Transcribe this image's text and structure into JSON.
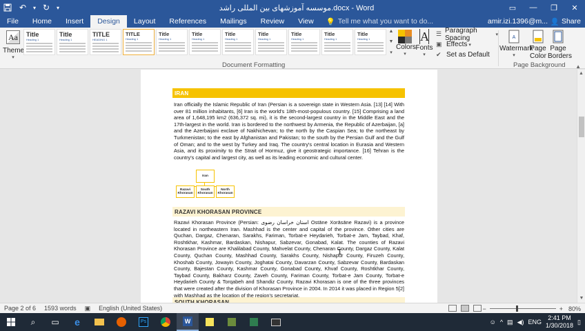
{
  "window": {
    "title": "موسسه آموزشهای بین المللی راشد.docx - Word",
    "controls": [
      "minimize",
      "restore",
      "maximize",
      "close"
    ]
  },
  "quick_access": [
    "save-icon",
    "undo-icon",
    "redo-icon",
    "customize-icon"
  ],
  "ribbon_tabs": [
    "File",
    "Home",
    "Insert",
    "Design",
    "Layout",
    "References",
    "Mailings",
    "Review",
    "View"
  ],
  "active_tab": "Design",
  "tell_me": "Tell me what you want to do...",
  "account": "amir.izi.1396@m...",
  "share": "Share",
  "ribbon": {
    "themes_label": "Themes",
    "style_gallery": [
      {
        "title": "Title",
        "heading": "Heading 1"
      },
      {
        "title": "Title",
        "heading": "Heading 1"
      },
      {
        "title": "TITLE",
        "heading": "HEADING 1"
      },
      {
        "title": "TITLE",
        "heading": "Heading 1"
      },
      {
        "title": "Title",
        "heading": "Heading 1"
      },
      {
        "title": "Title",
        "heading": "Heading 1"
      },
      {
        "title": "Title",
        "heading": "Heading 1"
      },
      {
        "title": "Title",
        "heading": "Heading 1"
      },
      {
        "title": "Title",
        "heading": "Heading 1"
      },
      {
        "title": "Title",
        "heading": "Heading 1"
      },
      {
        "title": "Title",
        "heading": "Heading 1"
      }
    ],
    "colors_label": "Colors",
    "fonts_label": "Fonts",
    "paragraph_spacing": "Paragraph Spacing",
    "effects": "Effects",
    "set_as_default": "Set as Default",
    "document_formatting_group": "Document Formatting",
    "watermark": "Watermark",
    "page_color": "Page Color",
    "page_borders": "Page Borders",
    "page_background_group": "Page Background",
    "theme_colors": [
      "#f6c200",
      "#e98d22",
      "#2b2b2b",
      "#7a7a7a"
    ]
  },
  "document": {
    "heading1": "IRAN",
    "para1": "Iran officially the Islamic Republic of Iran (Persian is a sovereign state in Western Asia. [13] [14] With over 81 million inhabitants, [6] Iran is the world's 18th-most-populous country. [15] Comprising a land area of 1,648,195 km2 (636,372 sq. mi), it is the second-largest country in the Middle East and the 17th-largest in the world. Iran is bordered to the northwest by Armenia, the Republic of Azerbaijan, [a] and the Azerbaijani exclave of Nakhichevan; to the north by the Caspian Sea; to the northeast by Turkmenistan; to the east by Afghanistan and Pakistan; to the south by the Persian Gulf and the Gulf of Oman; and to the west by Turkey and Iraq. The country's central location in Eurasia and Western Asia, and its proximity to the Strait of Hormuz, give it geostrategic importance. [16] Tehran is the country's capital and largest city, as well as its leading economic and cultural center.",
    "org_chart": {
      "root": "Iran",
      "children": [
        "Razavi Khorasan",
        "South Khorasan",
        "North Khorasan"
      ]
    },
    "heading2": "RAZAVI KHORASAN PROVINCE",
    "para2": "Razavi Khorasan Province (Persian: استان خراسان رضوی Ostāne Xorāsāne Razavi) is a province located in northeastern Iran. Mashhad is the center and capital of the province. Other cities are Quchan, Dargaz, Chenaran, Sarakhs, Fariman, Torbat-e Heydarieh, Torbat-e Jam, Taybad, Khaf, Roshtkhar, Kashmar, Bardaskan, Nishapur, Sabzevar, Gonabad, Kalat. The counties of Razavi Khorasan Province are Khalilabad County, Mahvelat County, Chenaran County, Dargaz County, Kalat County, Quchan County, Mashhad County, Sarakhs County, Nishapur County, Firuzeh County, Khoshab County, Jowayin County, Joghatai County, Davarzan County, Sabzevar County, Bardaskan County, Bajestan County, Kashmar County, Gonabad County, Khvaf County, Roshtkhar County, Taybad County, Bakharz County, Zaveh County, Fariman County, Torbat-e Jam County, Torbat-e Heydarieh County & Torqabeh and Shandiz County. Razavi Khorasan is one of the three provinces that were created after the division of Khorasan Province in 2004. In 2014 it was placed in Region 5[2] with Mashhad as the location of the region's secretariat.",
    "heading3": "SOUTH KHORASAN"
  },
  "status": {
    "page": "Page 2 of 6",
    "words": "1593 words",
    "language": "English (United States)",
    "zoom_out": "−",
    "zoom_in": "+",
    "zoom": "80%"
  },
  "taskbar": {
    "items": [
      "start-icon",
      "search-icon",
      "task-view-icon",
      "edge-icon",
      "file-explorer-icon",
      "firefox-icon",
      "photoshop-icon",
      "chrome-icon",
      "word-icon",
      "sticky-notes-icon",
      "app-icon-1",
      "app-icon-2",
      "photos-icon"
    ],
    "time": "2:41 PM",
    "date": "1/30/2018",
    "lang": "ENG"
  }
}
